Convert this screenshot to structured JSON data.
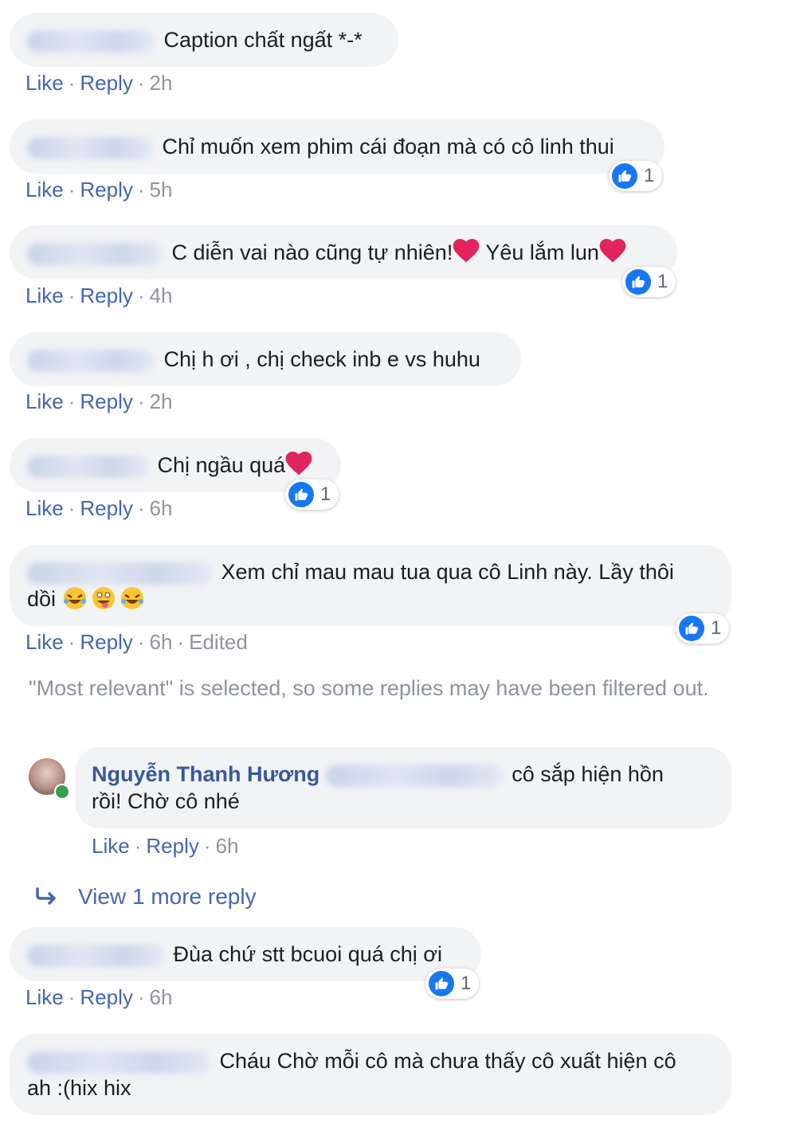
{
  "actions": {
    "like": "Like",
    "reply": "Reply",
    "dot": "·"
  },
  "comments": [
    {
      "text": "Caption chất ngất *-*",
      "time": "2h"
    },
    {
      "text": "Chỉ muốn xem phim cái đoạn mà có cô linh thui",
      "time": "5h",
      "reactions": "1"
    },
    {
      "text_a": "C diễn vai nào cũng tự nhiên!",
      "text_b": " Yêu lắm lun",
      "time": "4h",
      "reactions": "1"
    },
    {
      "text": "Chị h ơi , chị check inb e vs huhu",
      "time": "2h"
    },
    {
      "text": "Chị ngầu quá",
      "time": "6h",
      "reactions": "1"
    },
    {
      "text_line1": "Xem chỉ mau mau tua qua cô Linh này. Lầy thôi",
      "text_line2": "dồi",
      "time": "6h",
      "edited": "Edited",
      "reactions": "1"
    },
    {
      "text": "Đùa chứ stt bcuoi quá chị ơi",
      "time": "6h",
      "reactions": "1"
    },
    {
      "text_line1": "Cháu Chờ mỗi cô mà chưa thấy cô xuất hiện cô",
      "text_line2": "ah :(hix hix"
    }
  ],
  "filter_note": "\"Most relevant\" is selected, so some replies may have been filtered out.",
  "reply": {
    "author": "Nguyễn Thanh Hương",
    "text_line1": "cô sắp hiện hồn",
    "text_line2": "rồi! Chờ cô nhé",
    "time": "6h"
  },
  "view_more": "View 1 more reply",
  "colors": {
    "link": "#4267b2",
    "bubble": "#f2f3f5",
    "like_blue": "#1877f2",
    "heart": "#e0245e",
    "muted": "#90949c"
  },
  "icons": {
    "like": "thumbs-up-icon",
    "heart": "heart-icon",
    "reply_arrow": "reply-arrow-icon"
  }
}
